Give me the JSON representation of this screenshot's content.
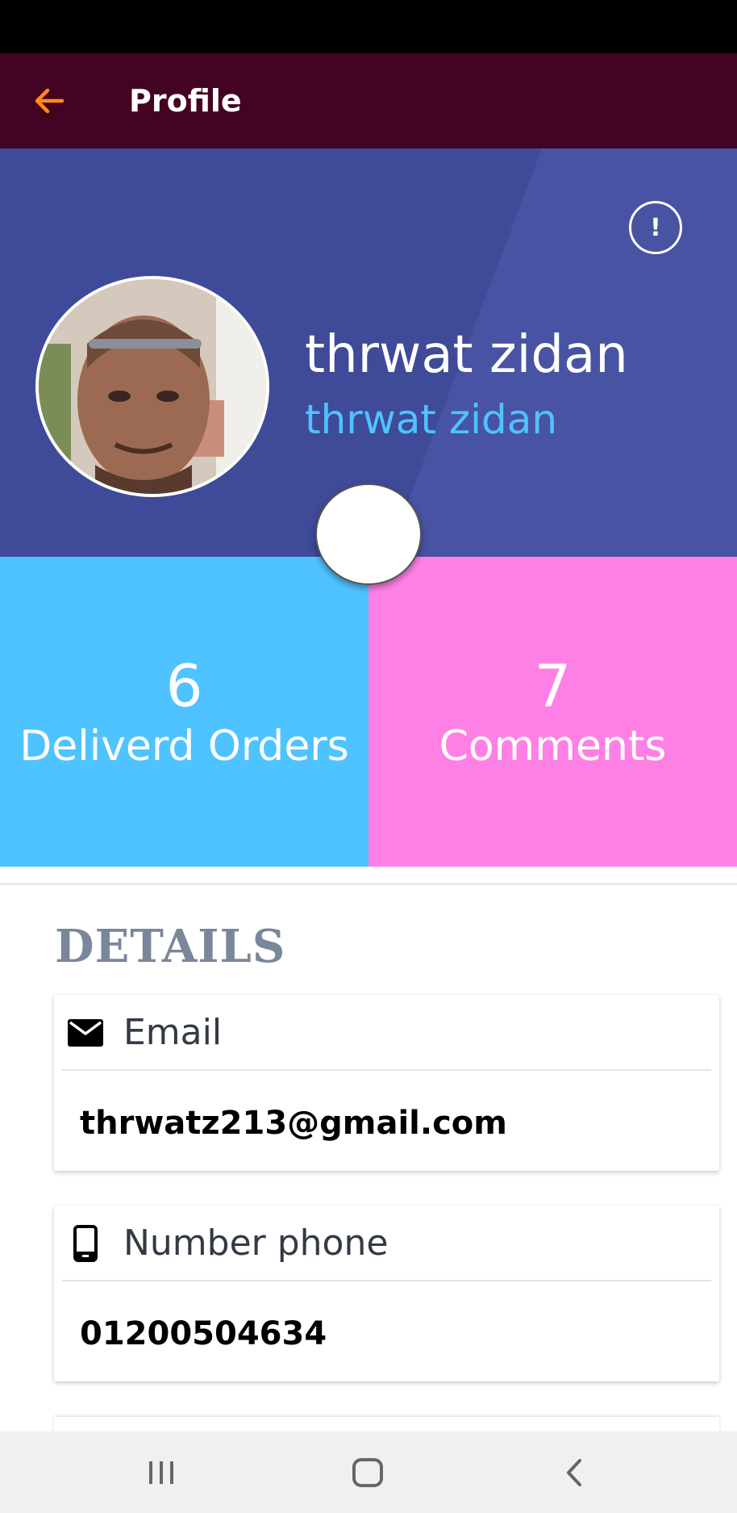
{
  "app_bar": {
    "title": "Profile",
    "back_icon": "arrow-left-icon",
    "background": "#430322",
    "accent": "#ff8c1a"
  },
  "hero": {
    "name": "thrwat zidan",
    "username": "thrwat zidan",
    "info_icon_glyph": "!",
    "background": "#3f4a98",
    "name_color": "#ffffff",
    "username_color": "#4fc3ff"
  },
  "stats": {
    "orders": {
      "value": "6",
      "label": "Deliverd Orders",
      "color": "#4fc3ff"
    },
    "comments": {
      "value": "7",
      "label": "Comments",
      "color": "#ff80e5"
    }
  },
  "details": {
    "title": "DETAILS",
    "email": {
      "label": "Email",
      "value": "thrwatz213@gmail.com",
      "icon": "mail-icon"
    },
    "phone": {
      "label": "Number phone",
      "value": "01200504634",
      "icon": "phone-icon"
    }
  },
  "nav": {
    "recents_icon": "recents-icon",
    "home_icon": "home-icon",
    "back_icon": "back-chevron-icon"
  }
}
